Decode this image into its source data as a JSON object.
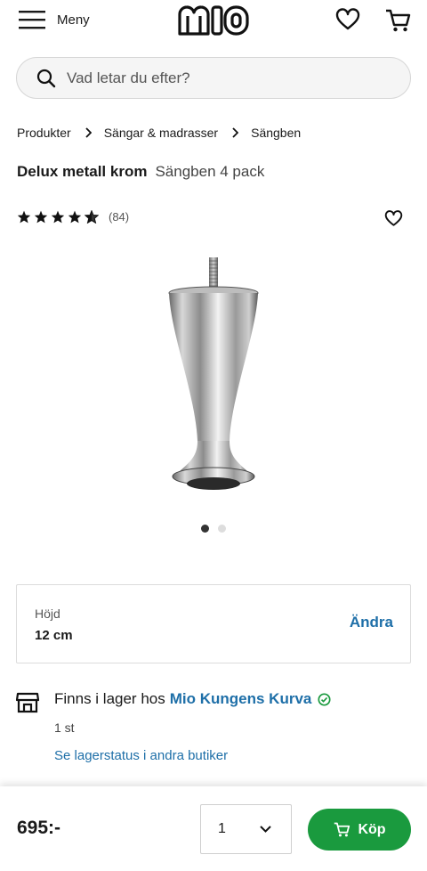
{
  "header": {
    "menu_label": "Meny",
    "logo_text": "mio",
    "icons": [
      "hamburger-icon",
      "heart-icon",
      "cart-icon"
    ]
  },
  "search": {
    "placeholder": "Vad letar du efter?",
    "icon": "search-icon"
  },
  "breadcrumb": {
    "items": [
      "Produkter",
      "Sängar & madrasser",
      "Sängben"
    ]
  },
  "product": {
    "name": "Delux metall krom",
    "subtitle": "Sängben 4 pack",
    "rating": 4.5,
    "rating_count": "(84)",
    "image_count": 2,
    "active_image": 1
  },
  "option": {
    "label": "Höjd",
    "value": "12 cm",
    "change_label": "Ändra"
  },
  "stock": {
    "text": "Finns i lager hos",
    "store": "Mio Kungens Kurva",
    "quantity": "1 st",
    "other_stores_link": "Se lagerstatus i andra butiker"
  },
  "purchase": {
    "price": "695:-",
    "quantity": "1",
    "buy_label": "Köp"
  },
  "colors": {
    "brand_blue": "#1e6fa8",
    "buy_green": "#1a9a3e",
    "in_stock_green": "#1a9a3e"
  }
}
